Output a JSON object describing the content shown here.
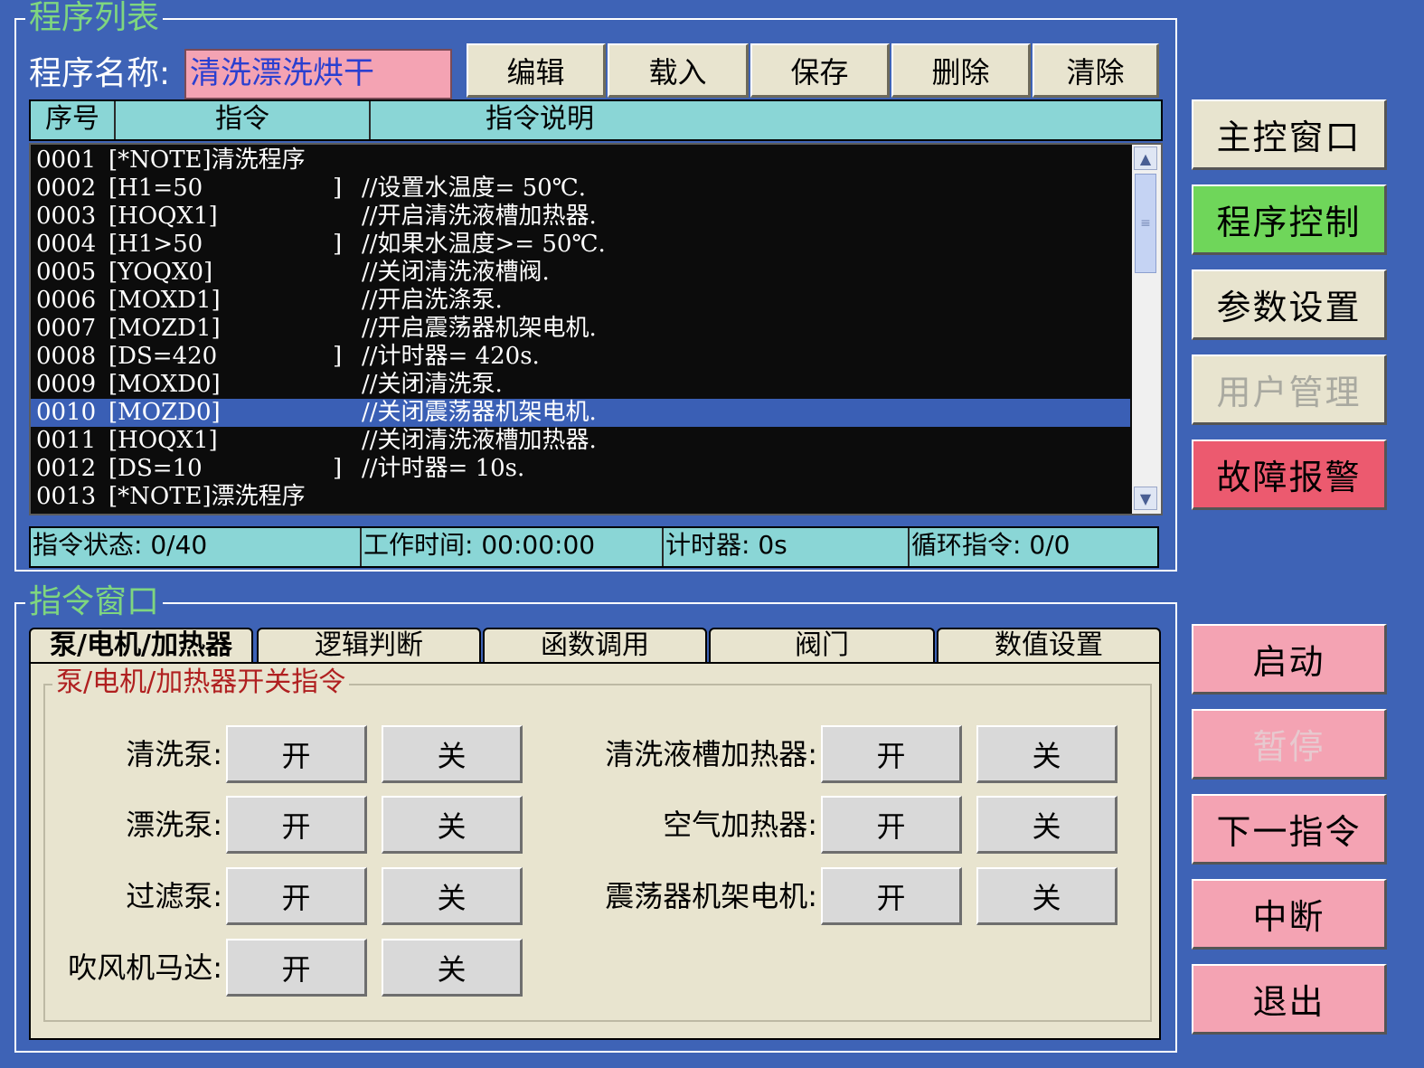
{
  "program_list": {
    "title": "程序列表",
    "name_label": "程序名称:",
    "name_value": "清洗漂洗烘干",
    "buttons": [
      "编辑",
      "载入",
      "保存",
      "删除",
      "清除"
    ],
    "columns": [
      "序号",
      "指令",
      "指令说明"
    ],
    "rows": [
      {
        "no": "0001",
        "cmd": "[*NOTE]清洗程序",
        "br": "",
        "desc": ""
      },
      {
        "no": "0002",
        "cmd": "[H1=50",
        "br": "]",
        "desc": "//设置水温度= 50℃."
      },
      {
        "no": "0003",
        "cmd": "[HOQX1]",
        "br": "",
        "desc": "//开启清洗液槽加热器."
      },
      {
        "no": "0004",
        "cmd": "[H1>50",
        "br": "]",
        "desc": "//如果水温度>= 50℃."
      },
      {
        "no": "0005",
        "cmd": "[YOQX0]",
        "br": "",
        "desc": "//关闭清洗液槽阀."
      },
      {
        "no": "0006",
        "cmd": "[MOXD1]",
        "br": "",
        "desc": "//开启洗涤泵."
      },
      {
        "no": "0007",
        "cmd": "[MOZD1]",
        "br": "",
        "desc": "//开启震荡器机架电机."
      },
      {
        "no": "0008",
        "cmd": "[DS=420",
        "br": "]",
        "desc": "//计时器= 420s."
      },
      {
        "no": "0009",
        "cmd": "[MOXD0]",
        "br": "",
        "desc": "//关闭清洗泵."
      },
      {
        "no": "0010",
        "cmd": "[MOZD0]",
        "br": "",
        "desc": "//关闭震荡器机架电机."
      },
      {
        "no": "0011",
        "cmd": "[HOQX1]",
        "br": "",
        "desc": "//关闭清洗液槽加热器."
      },
      {
        "no": "0012",
        "cmd": "[DS=10",
        "br": "]",
        "desc": "//计时器= 10s."
      },
      {
        "no": "0013",
        "cmd": "[*NOTE]漂洗程序",
        "br": "",
        "desc": ""
      }
    ],
    "selected_row": "0010",
    "status": {
      "cmd_state": "指令状态: 0/40",
      "work_time": "工作时间: 00:00:00",
      "timer": "计时器: 0s",
      "loop": "循环指令: 0/0"
    }
  },
  "command_window": {
    "title": "指令窗口",
    "tabs": [
      "泵/电机/加热器",
      "逻辑判断",
      "函数调用",
      "阀门",
      "数值设置"
    ],
    "active_tab": "泵/电机/加热器",
    "group_title": "泵/电机/加热器开关指令",
    "on_label": "开",
    "off_label": "关",
    "left_devices": [
      "清洗泵:",
      "漂洗泵:",
      "过滤泵:",
      "吹风机马达:"
    ],
    "right_devices": [
      "清洗液槽加热器:",
      "空气加热器:",
      "震荡器机架电机:"
    ]
  },
  "nav": {
    "main": "主控窗口",
    "program": "程序控制",
    "params": "参数设置",
    "users": "用户管理",
    "alarm": "故障报警"
  },
  "control": {
    "start": "启动",
    "pause": "暂停",
    "next": "下一指令",
    "interrupt": "中断",
    "exit": "退出"
  },
  "colors": {
    "background": "#3e63b6",
    "title_green": "#7fd67f",
    "active_nav": "#6fd65a",
    "alarm": "#ec5a6f",
    "pink_button": "#f4a3b3",
    "header_cyan": "#8ad6d6",
    "selection": "#3a5fb5"
  }
}
